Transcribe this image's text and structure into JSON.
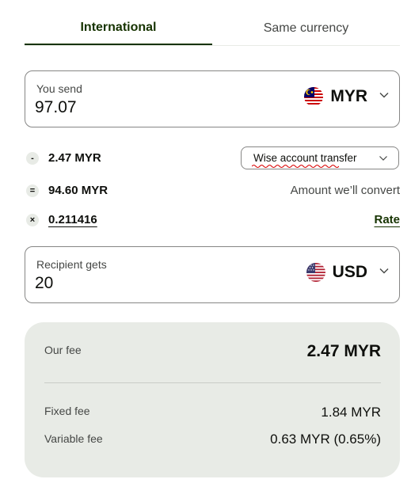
{
  "tabs": [
    {
      "label": "International",
      "active": true
    },
    {
      "label": "Same currency",
      "active": false
    }
  ],
  "send": {
    "label": "You send",
    "amount": "97.07",
    "currency": "MYR",
    "flag_icon": "malaysia-flag-icon"
  },
  "fees": {
    "fee_amount": "2.47 MYR",
    "method_label": "Wise account transfer",
    "converted_amount": "94.60 MYR",
    "converted_caption": "Amount we’ll convert",
    "rate_value": "0.211416",
    "rate_link": "Rate",
    "operators": {
      "minus": "-",
      "equals": "=",
      "times": "×"
    }
  },
  "receive": {
    "label": "Recipient gets",
    "amount": "20",
    "currency": "USD",
    "flag_icon": "usa-flag-icon"
  },
  "summary": {
    "our_fee_label": "Our fee",
    "our_fee_value": "2.47 MYR",
    "fixed_fee_label": "Fixed fee",
    "fixed_fee_value": "1.84 MYR",
    "variable_fee_label": "Variable fee",
    "variable_fee_value": "0.63 MYR (0.65%)"
  },
  "colors": {
    "brand_dark_green": "#163300",
    "summary_bg": "#e8ebe6",
    "border": "#868685",
    "spellcheck_red": "#d80000"
  }
}
